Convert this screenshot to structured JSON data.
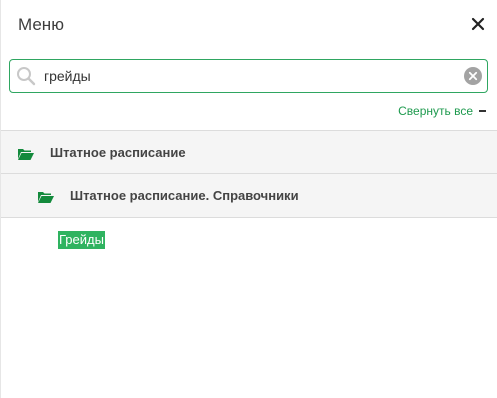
{
  "header": {
    "title": "Меню",
    "close_icon": "close-icon"
  },
  "search": {
    "value": "грейды",
    "placeholder": "",
    "icon": "search-icon",
    "clear_icon": "clear-icon"
  },
  "collapse": {
    "label": "Свернуть все",
    "icon": "minus-icon"
  },
  "tree": [
    {
      "label": "Штатное расписание",
      "icon": "folder-open-icon",
      "level": 1
    },
    {
      "label": "Штатное расписание. Справочники",
      "icon": "folder-open-icon",
      "level": 2
    }
  ],
  "result": {
    "label": "Грейды"
  },
  "colors": {
    "accent": "#2fb360",
    "accent_text": "#1e9a4e",
    "row_bg": "#f5f5f5",
    "border": "#dcdcdc"
  }
}
